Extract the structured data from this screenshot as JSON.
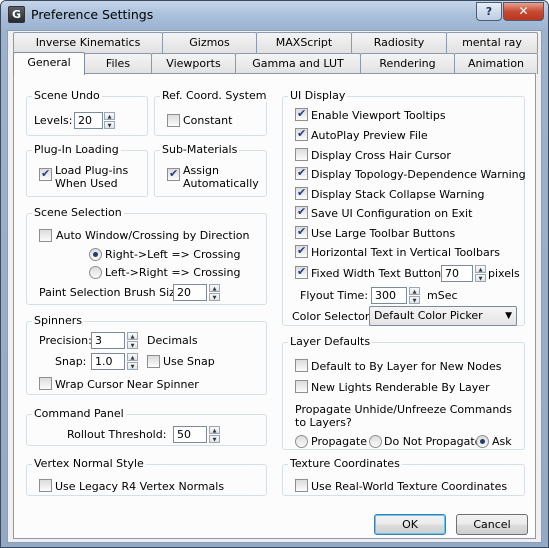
{
  "window": {
    "title": "Preference Settings",
    "app_icon_letter": "G",
    "help_label": "?",
    "close_label": "✕"
  },
  "tabs_row1": [
    "Inverse Kinematics",
    "Gizmos",
    "MAXScript",
    "Radiosity",
    "mental ray"
  ],
  "tabs_row2": [
    "General",
    "Files",
    "Viewports",
    "Gamma and LUT",
    "Rendering",
    "Animation"
  ],
  "active_tab": "General",
  "scene_undo": {
    "title": "Scene Undo",
    "levels_label": "Levels:",
    "levels_value": "20"
  },
  "ref_coord": {
    "title": "Ref. Coord. System",
    "constant_label": "Constant",
    "constant_checked": false
  },
  "plugin_loading": {
    "title": "Plug-In Loading",
    "load_line1": "Load Plug-ins",
    "load_line2": "When Used",
    "checked": true
  },
  "sub_materials": {
    "title": "Sub-Materials",
    "assign_line1": "Assign",
    "assign_line2": "Automatically",
    "checked": true
  },
  "scene_selection": {
    "title": "Scene Selection",
    "auto_window_label": "Auto Window/Crossing by Direction",
    "auto_window_checked": false,
    "right_left_label": "Right->Left => Crossing",
    "left_right_label": "Left->Right => Crossing",
    "selected": "right_left",
    "brush_label": "Paint Selection Brush Size",
    "brush_value": "20"
  },
  "spinners": {
    "title": "Spinners",
    "precision_label": "Precision:",
    "precision_value": "3",
    "decimals_label": "Decimals",
    "snap_label": "Snap:",
    "snap_value": "1.0",
    "use_snap_label": "Use Snap",
    "use_snap_checked": false,
    "wrap_label": "Wrap Cursor Near Spinner",
    "wrap_checked": false
  },
  "command_panel": {
    "title": "Command Panel",
    "rollout_label": "Rollout Threshold:",
    "rollout_value": "50"
  },
  "vertex_normal": {
    "title": "Vertex Normal Style",
    "legacy_label": "Use Legacy R4 Vertex Normals",
    "legacy_checked": false
  },
  "ui_display": {
    "title": "UI Display",
    "items": [
      {
        "label": "Enable Viewport Tooltips",
        "checked": true
      },
      {
        "label": "AutoPlay Preview File",
        "checked": true
      },
      {
        "label": "Display Cross Hair Cursor",
        "checked": false
      },
      {
        "label": "Display Topology-Dependence Warning",
        "checked": true
      },
      {
        "label": "Display Stack Collapse Warning",
        "checked": true
      },
      {
        "label": "Save UI Configuration on Exit",
        "checked": true
      },
      {
        "label": "Use Large Toolbar Buttons",
        "checked": true
      },
      {
        "label": "Horizontal Text in Vertical Toolbars",
        "checked": true
      }
    ],
    "fixed_width_label": "Fixed Width Text Buttons:",
    "fixed_width_checked": true,
    "fixed_width_value": "70",
    "pixels_label": "pixels",
    "flyout_label": "Flyout Time:",
    "flyout_value": "300",
    "msec_label": "mSec",
    "color_selector_label": "Color Selector:",
    "color_selector_value": "Default Color Picker"
  },
  "layer_defaults": {
    "title": "Layer Defaults",
    "default_bylayer_label": "Default to By Layer for New Nodes",
    "default_bylayer_checked": false,
    "new_lights_label": "New Lights Renderable By Layer",
    "new_lights_checked": false,
    "propagate_q1": "Propagate Unhide/Unfreeze Commands",
    "propagate_q2": "to Layers?",
    "opt_propagate": "Propagate",
    "opt_no_propagate": "Do Not Propagate",
    "opt_ask": "Ask",
    "selected": "ask"
  },
  "texture_coords": {
    "title": "Texture Coordinates",
    "realworld_label": "Use Real-World Texture Coordinates",
    "realworld_checked": false
  },
  "buttons": {
    "ok": "OK",
    "cancel": "Cancel"
  }
}
